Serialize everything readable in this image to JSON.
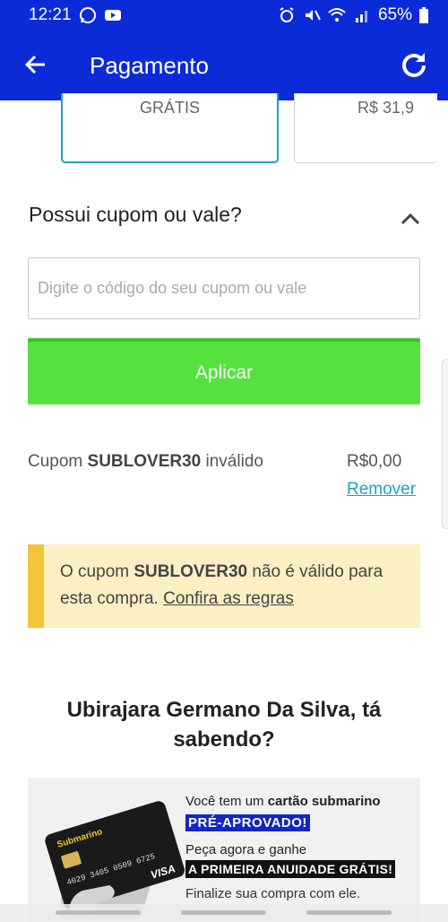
{
  "status_bar": {
    "time": "12:21",
    "battery": "65%"
  },
  "app_bar": {
    "title": "Pagamento",
    "back_icon": "arrow-left-icon",
    "refresh_icon": "refresh-icon"
  },
  "shipping_options": [
    {
      "price": "GRÁTIS",
      "selected": true
    },
    {
      "price": "R$ 31,9",
      "selected": false
    }
  ],
  "coupon": {
    "title": "Possui cupom ou vale?",
    "input_placeholder": "Digite o código do seu cupom ou vale",
    "input_value": "",
    "apply_label": "Aplicar",
    "status_prefix": "Cupom",
    "code": "SUBLOVER30",
    "status_suffix": "inválido",
    "discount_value": "R$0,00",
    "remove_label": "Remover"
  },
  "alert": {
    "prefix": "O cupom",
    "code": "SUBLOVER30",
    "middle": "não é válido para esta compra.",
    "link_label": "Confira as regras"
  },
  "greeting": "Ubirajara Germano Da Silva, tá sabendo?",
  "banner": {
    "line1_prefix": "Você tem um",
    "line1_bold": "cartão submarino",
    "tag1": "PRÉ-APROVADO!",
    "line2": "Peça agora e ganhe",
    "tag2": "A PRIMEIRA ANUIDADE GRÁTIS!",
    "line3": "Finalize sua compra com ele.",
    "card_brand": "Submarino",
    "card_number": "4029 3405 0509 6725",
    "card_network": "VISA"
  },
  "colors": {
    "primary": "#0b2bd9",
    "apply_button": "#55e23f",
    "link": "#1da1c8",
    "alert_bg": "#fbefc3",
    "alert_border": "#f2c43b"
  }
}
